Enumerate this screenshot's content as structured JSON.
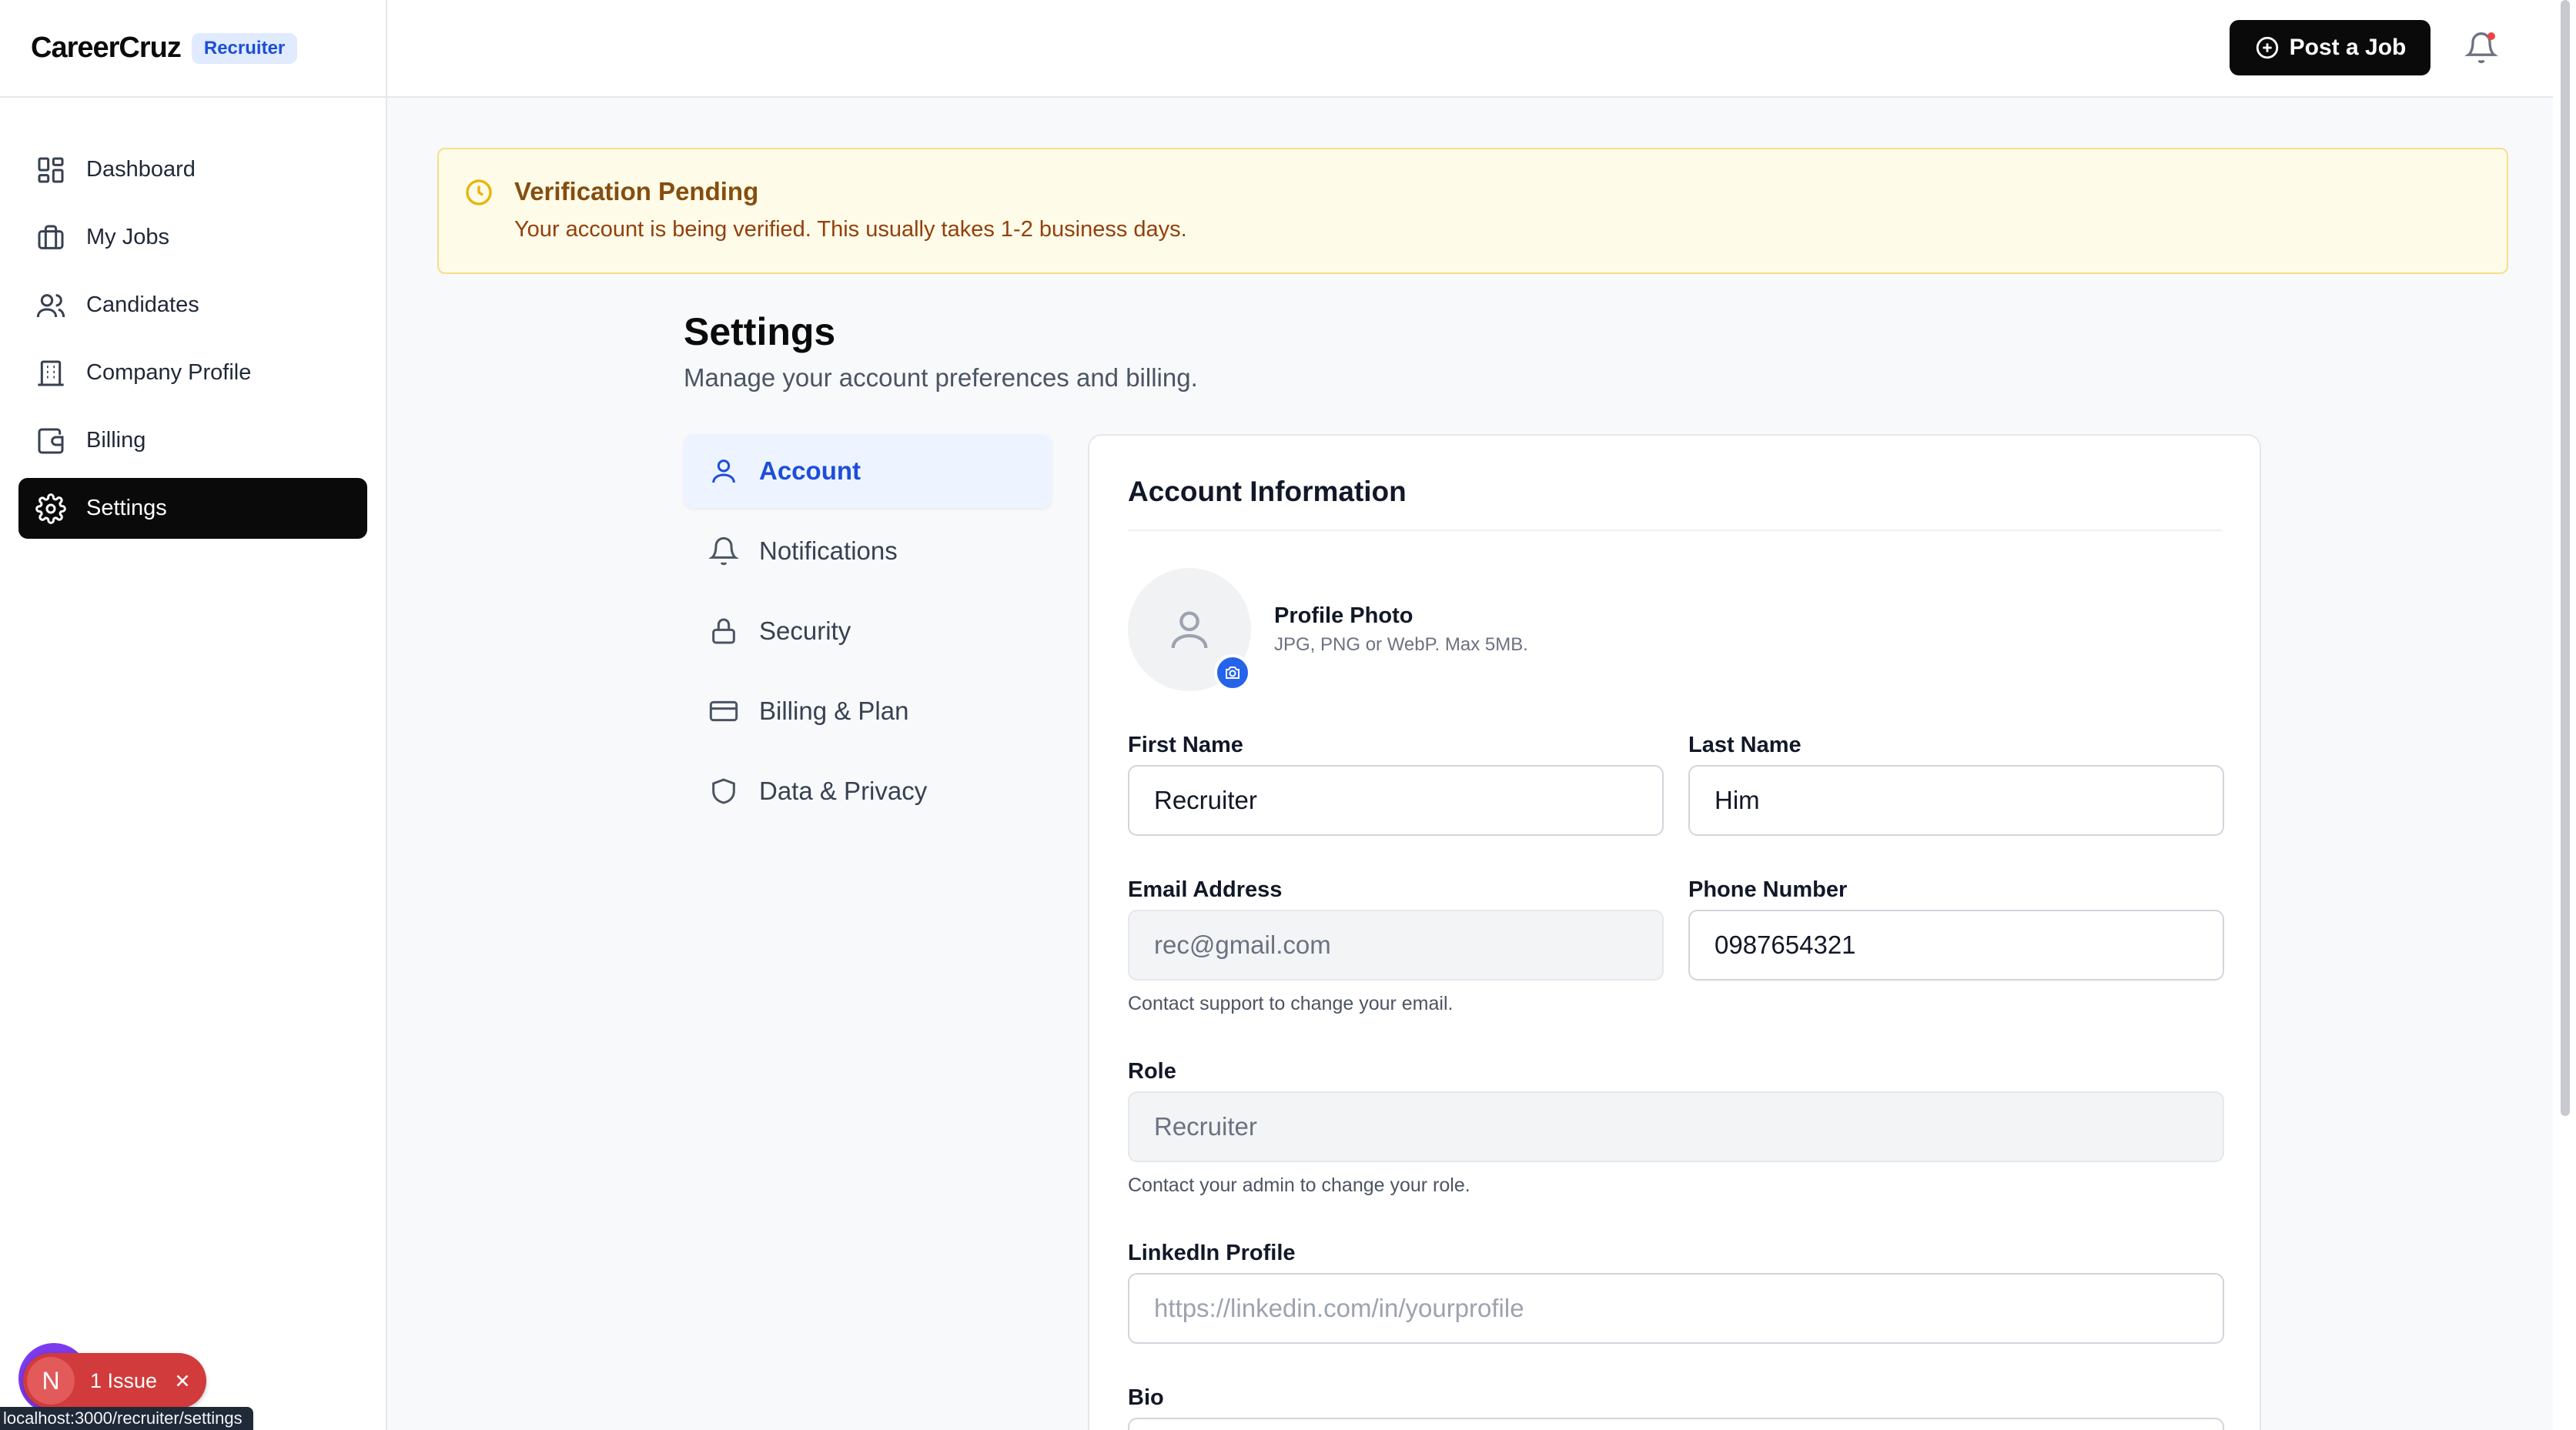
{
  "brand": {
    "name": "CareerCruz",
    "badge": "Recruiter"
  },
  "sidebar": {
    "items": [
      {
        "label": "Dashboard",
        "icon": "dashboard-icon",
        "active": false
      },
      {
        "label": "My Jobs",
        "icon": "briefcase-icon",
        "active": false
      },
      {
        "label": "Candidates",
        "icon": "users-icon",
        "active": false
      },
      {
        "label": "Company Profile",
        "icon": "building-icon",
        "active": false
      },
      {
        "label": "Billing",
        "icon": "wallet-icon",
        "active": false
      },
      {
        "label": "Settings",
        "icon": "gear-icon",
        "active": true
      }
    ]
  },
  "header": {
    "post_job_label": "Post a Job",
    "notification_icon": "bell-icon"
  },
  "banner": {
    "title": "Verification Pending",
    "message": "Your account is being verified. This usually takes 1-2 business days."
  },
  "page": {
    "title": "Settings",
    "subtitle": "Manage your account preferences and billing."
  },
  "settings_tabs": [
    {
      "label": "Account",
      "icon": "user-icon",
      "active": true
    },
    {
      "label": "Notifications",
      "icon": "bell-icon",
      "active": false
    },
    {
      "label": "Security",
      "icon": "lock-icon",
      "active": false
    },
    {
      "label": "Billing & Plan",
      "icon": "credit-card-icon",
      "active": false
    },
    {
      "label": "Data & Privacy",
      "icon": "shield-icon",
      "active": false
    }
  ],
  "account": {
    "section_title": "Account Information",
    "photo": {
      "label": "Profile Photo",
      "hint": "JPG, PNG or WebP. Max 5MB."
    },
    "first_name": {
      "label": "First Name",
      "value": "Recruiter"
    },
    "last_name": {
      "label": "Last Name",
      "value": "Him"
    },
    "email": {
      "label": "Email Address",
      "value": "rec@gmail.com",
      "hint": "Contact support to change your email."
    },
    "phone": {
      "label": "Phone Number",
      "value": "0987654321"
    },
    "role": {
      "label": "Role",
      "value": "Recruiter",
      "hint": "Contact your admin to change your role."
    },
    "linkedin": {
      "label": "LinkedIn Profile",
      "placeholder": "https://linkedin.com/in/yourprofile"
    },
    "bio": {
      "label": "Bio"
    }
  },
  "dev_overlay": {
    "avatar_letter": "N",
    "issues_label": "1 Issue",
    "status_url": "localhost:3000/recruiter/settings"
  },
  "colors": {
    "accent": "#1d4ed8",
    "active_nav": "#0a0a0a",
    "banner_bg": "#fefbe8",
    "banner_text": "#854d0e",
    "issue_red": "#d13b3b"
  }
}
